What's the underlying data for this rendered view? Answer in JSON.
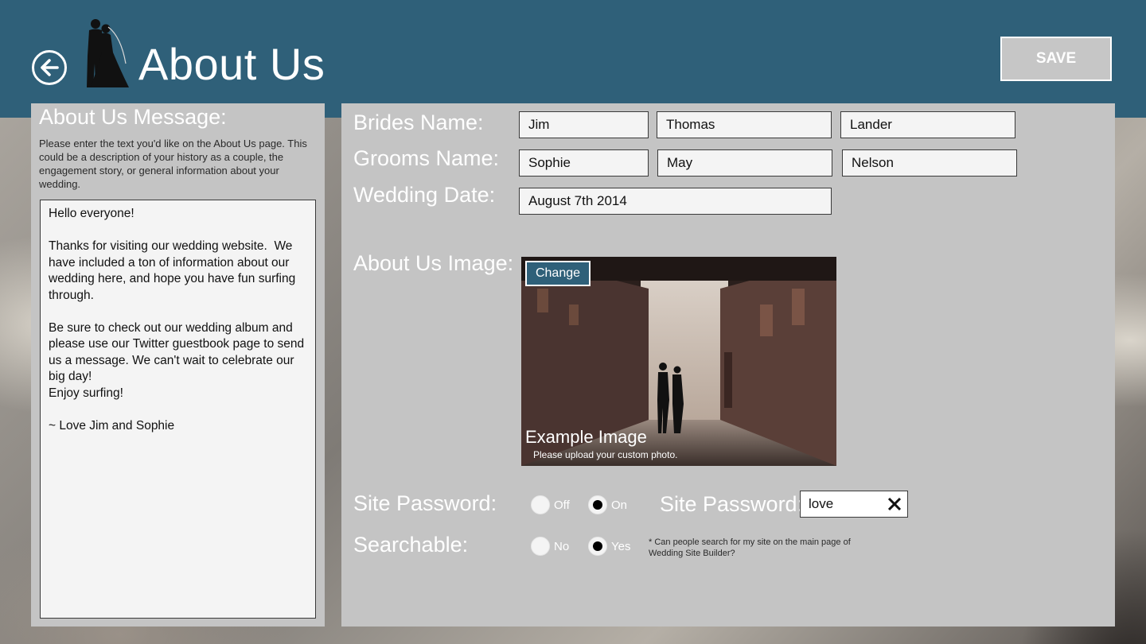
{
  "header": {
    "title": "About Us",
    "save_label": "SAVE",
    "colors": {
      "header_bg": "#2f6079",
      "panel_bg": "#c4c4c4",
      "accent": "#2f6079"
    },
    "icons": {
      "back": "back-arrow-icon",
      "logo": "bride-groom-silhouette-icon"
    }
  },
  "left": {
    "title": "About Us Message:",
    "description": "Please enter the text you'd like on the About Us page. This could be a description of your history as a couple, the engagement story, or general information about your wedding.",
    "message": "Hello everyone!\n\nThanks for visiting our wedding website.  We have included a ton of information about our wedding here, and hope you have fun surfing through.\n\nBe sure to check out our wedding album and please use our Twitter guestbook page to send us a message. We can't wait to celebrate our big day!\nEnjoy surfing!\n\n~ Love Jim and Sophie"
  },
  "form": {
    "brides_label": "Brides Name:",
    "brides": {
      "first": "Jim",
      "middle": "Thomas",
      "last": "Lander"
    },
    "grooms_label": "Grooms Name:",
    "grooms": {
      "first": "Sophie",
      "middle": "May",
      "last": "Nelson"
    },
    "date_label": "Wedding Date:",
    "date": "August 7th 2014",
    "image_label": "About Us Image:",
    "image": {
      "change_label": "Change",
      "caption": "Example Image",
      "subcaption": "Please upload your custom photo."
    },
    "password": {
      "label": "Site Password:",
      "off_label": "Off",
      "on_label": "On",
      "selected": "On",
      "field_label": "Site Password:",
      "value": "love"
    },
    "searchable": {
      "label": "Searchable:",
      "no_label": "No",
      "yes_label": "Yes",
      "selected": "Yes",
      "note": "* Can people search for my site on the main page of Wedding Site Builder?"
    }
  }
}
